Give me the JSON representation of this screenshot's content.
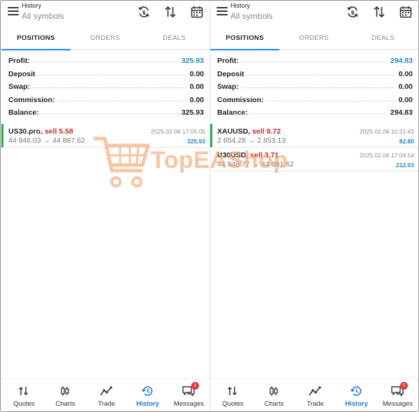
{
  "panels": [
    {
      "header": {
        "title": "History",
        "subtitle": "All symbols"
      },
      "tabs": [
        {
          "label": "POSITIONS"
        },
        {
          "label": "ORDERS"
        },
        {
          "label": "DEALS"
        }
      ],
      "summary": [
        {
          "label": "Profit:",
          "value": "325.93",
          "highlight": true
        },
        {
          "label": "Deposit",
          "value": "0.00"
        },
        {
          "label": "Swap:",
          "value": "0.00"
        },
        {
          "label": "Commission:",
          "value": "0.00"
        },
        {
          "label": "Balance:",
          "value": "325.93"
        }
      ],
      "deals": [
        {
          "symbol": "US30.pro,",
          "side": "sell 5.58",
          "prices": "44 946.03 → 44 887.62",
          "time": "2025.02.06 17:05:05",
          "profit": "325.93",
          "marker": true
        }
      ]
    },
    {
      "header": {
        "title": "History",
        "subtitle": "All symbols"
      },
      "tabs": [
        {
          "label": "POSITIONS"
        },
        {
          "label": "ORDERS"
        },
        {
          "label": "DEALS"
        }
      ],
      "summary": [
        {
          "label": "Profit:",
          "value": "294.83",
          "highlight": true
        },
        {
          "label": "Deposit",
          "value": "0.00"
        },
        {
          "label": "Swap:",
          "value": "0.00"
        },
        {
          "label": "Commission:",
          "value": "0.00"
        },
        {
          "label": "Balance:",
          "value": "294.83"
        }
      ],
      "deals": [
        {
          "symbol": "XAUUSD,",
          "side": "sell 0.72",
          "prices": "2 854.28 → 2 853.13",
          "time": "2025.02.06 10:21:43",
          "profit": "82.80",
          "marker": true
        },
        {
          "symbol": "U30USD,",
          "side": "sell 3.71",
          "prices": "44 948.77 → 44 891.62",
          "time": "2025.02.06 17:04:54",
          "profit": "212.03",
          "marker": false
        }
      ]
    }
  ],
  "nav": [
    {
      "label": "Quotes",
      "icon": "quotes-icon"
    },
    {
      "label": "Charts",
      "icon": "charts-icon"
    },
    {
      "label": "Trade",
      "icon": "trade-icon"
    },
    {
      "label": "History",
      "icon": "history-icon",
      "active": true
    },
    {
      "label": "Messages",
      "icon": "messages-icon",
      "badge": "1"
    }
  ],
  "watermark": {
    "text": "TopEAShop"
  },
  "colors": {
    "accent": "#1e88e5",
    "profit": "#1e88c8",
    "sell": "#c62828",
    "marker": "#2eaa4a",
    "watermark": "#f4a36b"
  }
}
